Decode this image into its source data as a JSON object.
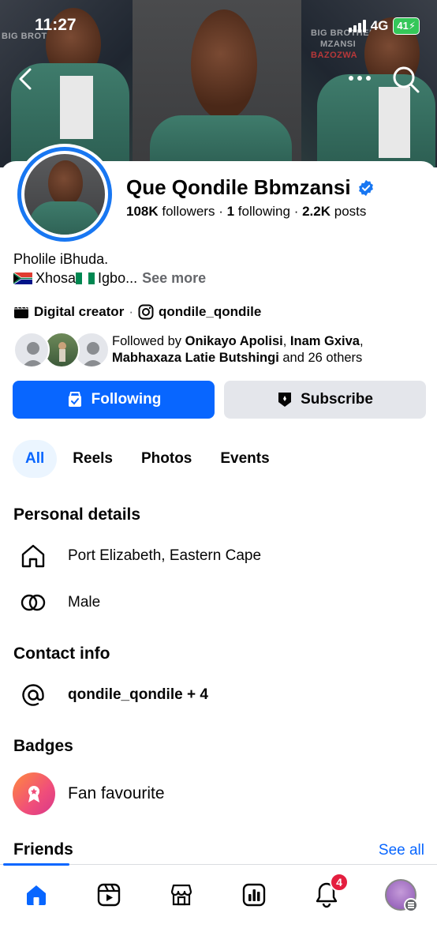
{
  "status_bar": {
    "time": "11:27",
    "network": "4G",
    "battery": "41"
  },
  "cover": {
    "texts": [
      "BIG BROTHER",
      "MZANSI",
      "BAZOZWA"
    ]
  },
  "profile": {
    "name": "Que Qondile Bbmzansi",
    "verified": true,
    "followers_count": "108K",
    "followers_label": "followers",
    "following_count": "1",
    "following_label": "following",
    "posts_count": "2.2K",
    "posts_label": "posts",
    "bio_line1": "Pholile iBhuda.",
    "bio_line2_part1": "Xhosa ",
    "bio_line2_part2": "Igbo...",
    "see_more": "See more",
    "category": "Digital creator",
    "instagram_handle": "qondile_qondile",
    "followed_by_prefix": "Followed by ",
    "followed_by_name1": "Onikayo Apolisi",
    "followed_by_sep": ", ",
    "followed_by_name2": "Inam Gxiva",
    "followed_by_sep2": ",",
    "followed_by_name3": "Mabhaxaza Latie Butshingi",
    "followed_by_suffix": " and 26 others"
  },
  "actions": {
    "following_label": "Following",
    "subscribe_label": "Subscribe"
  },
  "tabs": [
    {
      "label": "All",
      "active": true
    },
    {
      "label": "Reels",
      "active": false
    },
    {
      "label": "Photos",
      "active": false
    },
    {
      "label": "Events",
      "active": false
    }
  ],
  "personal_details": {
    "title": "Personal details",
    "location": "Port Elizabeth, Eastern Cape",
    "gender": "Male"
  },
  "contact_info": {
    "title": "Contact info",
    "handle": "qondile_qondile + 4"
  },
  "badges": {
    "title": "Badges",
    "item": "Fan favourite"
  },
  "friends": {
    "title": "Friends",
    "see_all": "See all"
  },
  "bottom_nav": {
    "items": [
      "home-icon",
      "reels-icon",
      "marketplace-icon",
      "dashboard-icon",
      "notifications-icon",
      "profile-menu-icon"
    ],
    "notification_count": "4"
  },
  "colors": {
    "accent": "#0866ff",
    "verified": "#1877f2",
    "badge_red": "#e41e3f"
  }
}
